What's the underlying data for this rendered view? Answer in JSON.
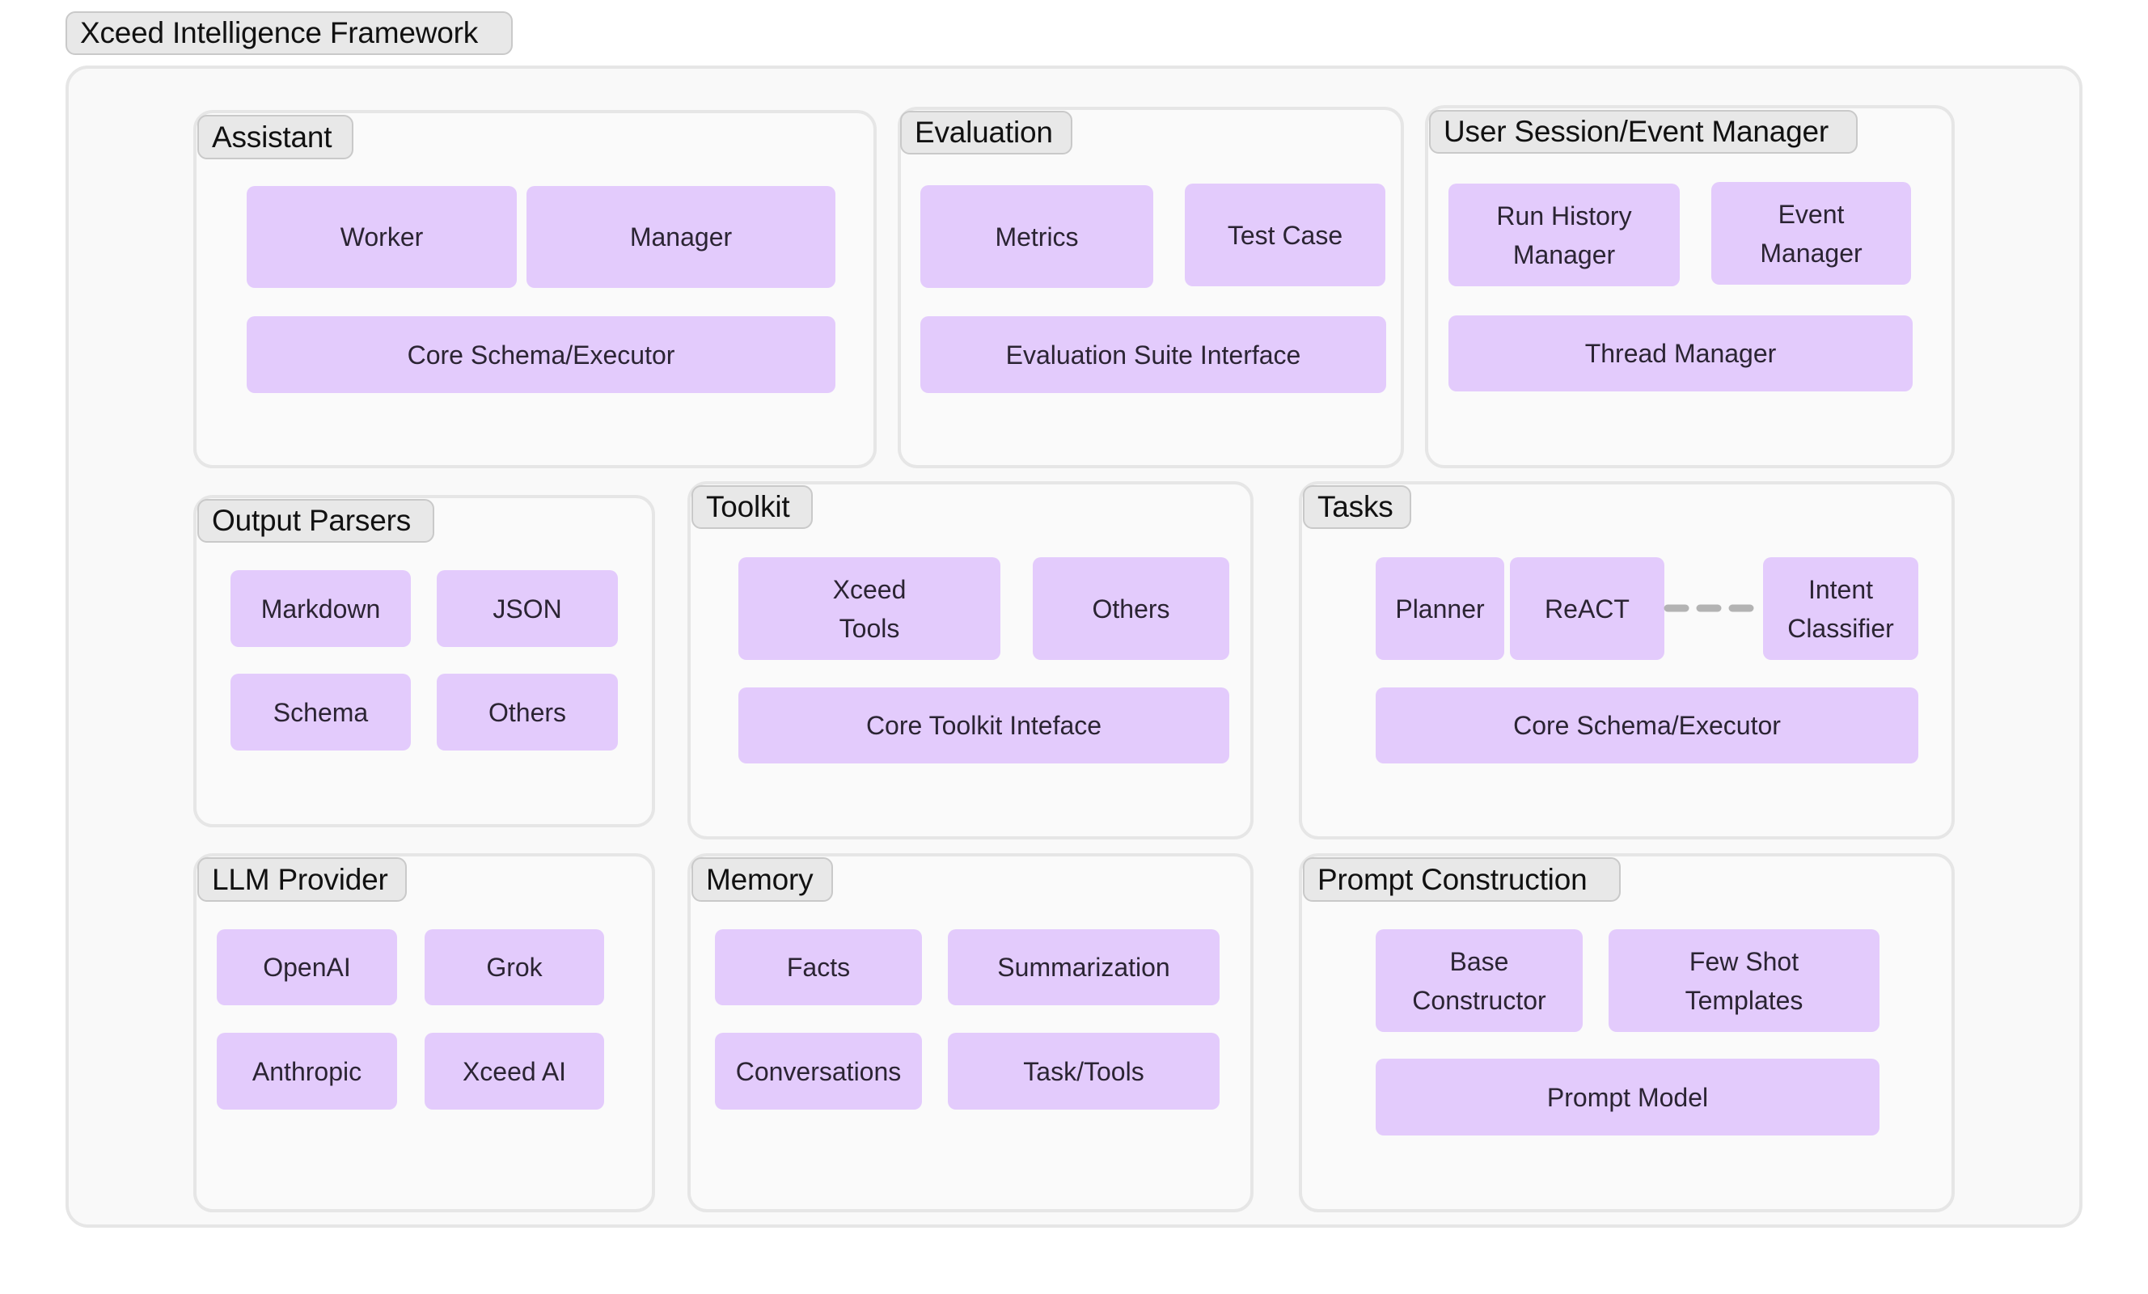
{
  "title": "Xceed Intelligence Framework",
  "colors": {
    "component_fill": "#e3cbfc",
    "component_text": "#2b2433",
    "group_border": "#e6e6e6",
    "group_background": "#fafafa",
    "label_background": "#e8e8e8",
    "connector": "#b3b3b3"
  },
  "groups": {
    "assistant": {
      "label": "Assistant",
      "components": [
        "Worker",
        "Manager",
        "Core Schema/Executor"
      ]
    },
    "evaluation": {
      "label": "Evaluation",
      "components": [
        "Metrics",
        "Test Case",
        "Evaluation Suite Interface"
      ]
    },
    "user_session": {
      "label": "User Session/Event Manager",
      "components": [
        "Run History\nManager",
        "Event\nManager",
        "Thread Manager"
      ]
    },
    "output_parsers": {
      "label": "Output Parsers",
      "components": [
        "Markdown",
        "JSON",
        "Schema",
        "Others"
      ]
    },
    "toolkit": {
      "label": "Toolkit",
      "components": [
        "Xceed\nTools",
        "Others",
        "Core Toolkit Inteface"
      ]
    },
    "tasks": {
      "label": "Tasks",
      "components": [
        "Planner",
        "ReACT",
        "Intent\nClassifier",
        "Core Schema/Executor"
      ],
      "connections": [
        {
          "from": "ReACT",
          "to": "Intent Classifier",
          "style": "dashed"
        }
      ]
    },
    "llm_provider": {
      "label": "LLM Provider",
      "components": [
        "OpenAI",
        "Grok",
        "Anthropic",
        "Xceed AI"
      ]
    },
    "memory": {
      "label": "Memory",
      "components": [
        "Facts",
        "Summarization",
        "Conversations",
        "Task/Tools"
      ]
    },
    "prompt_construction": {
      "label": "Prompt Construction",
      "components": [
        "Base\nConstructor",
        "Few Shot\nTemplates",
        "Prompt Model"
      ]
    }
  }
}
